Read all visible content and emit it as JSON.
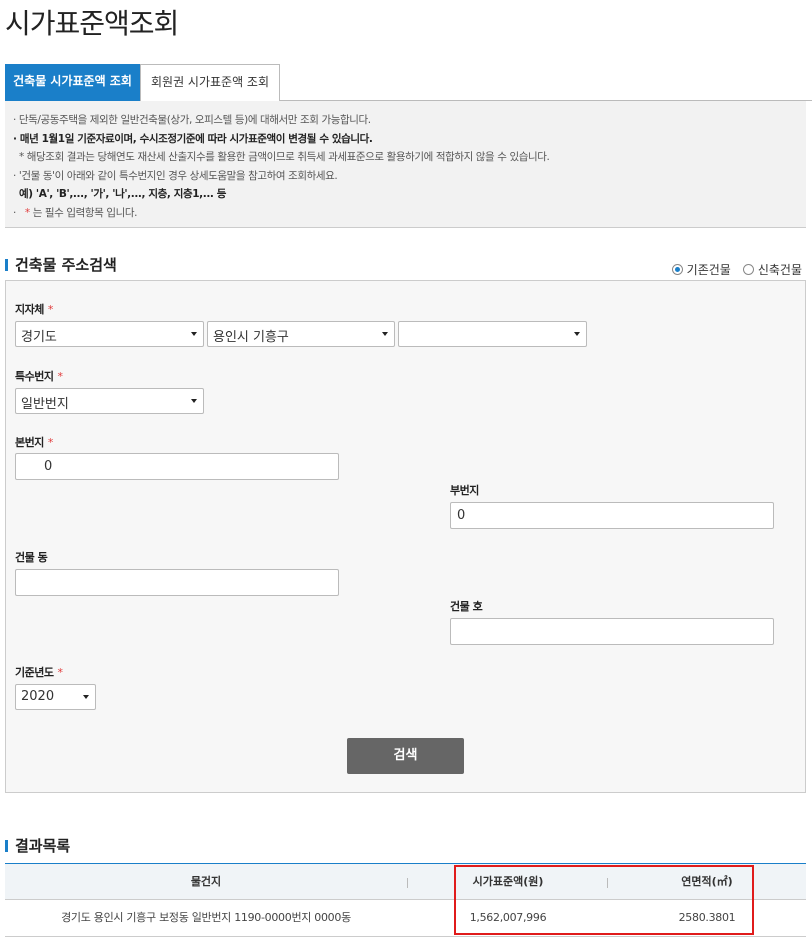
{
  "page": {
    "title": "시가표준액조회"
  },
  "tabs": [
    {
      "label": "건축물 시가표준액 조회",
      "active": true
    },
    {
      "label": "회원권 시가표준액 조회",
      "active": false
    }
  ],
  "notice": {
    "lines": [
      "· 단독/공동주택을 제외한 일반건축물(상가, 오피스텔 등)에 대해서만 조회 가능합니다.",
      "· 매년 1월1일 기준자료이며, 수시조정기준에 따라 시가표준액이 변경될 수 있습니다.",
      "  * 해당조회 결과는 당해연도 재산세 산출지수를 활용한 금액이므로 취득세 과세표준으로 활용하기에 적합하지 않을 수 있습니다.",
      "· '건물 동'이 아래와 같이 특수번지인 경우 상세도움말을 참고하여 조회하세요.",
      "  예) 'A', 'B',..., '가', '나',..., 지층, 지층1,... 등",
      "· ",
      "는 필수 입력항목 입니다."
    ],
    "required_star": "*"
  },
  "address_search": {
    "title": "건축물 주소검색",
    "radio_existing": "기존건물",
    "radio_new": "신축건물",
    "local_gov_label": "지자체",
    "province": "경기도",
    "city": "용인시 기흥구",
    "district": "",
    "special_lot_label": "특수번지",
    "special_lot_value": "일반번지",
    "main_lot_label": "본번지",
    "main_lot_value": "0",
    "sub_lot_label": "부번지",
    "sub_lot_value": "0",
    "building_dong_label": "건물 동",
    "building_dong_value": "",
    "building_ho_label": "건물 호",
    "building_ho_value": "",
    "base_year_label": "기준년도",
    "base_year_value": "2020",
    "search_button": "검색"
  },
  "results": {
    "title": "결과목록",
    "columns": [
      "물건지",
      "시가표준액(원)",
      "연면적(㎡)"
    ],
    "rows": [
      [
        "경기도 용인시 기흥구 보정동 일반번지 1190-0000번지 0000동",
        "1,562,007,996",
        "2580.3801"
      ]
    ]
  },
  "colors": {
    "accent": "#1a7fc9",
    "required": "#e03c3c",
    "highlight": "#e01b1b"
  }
}
